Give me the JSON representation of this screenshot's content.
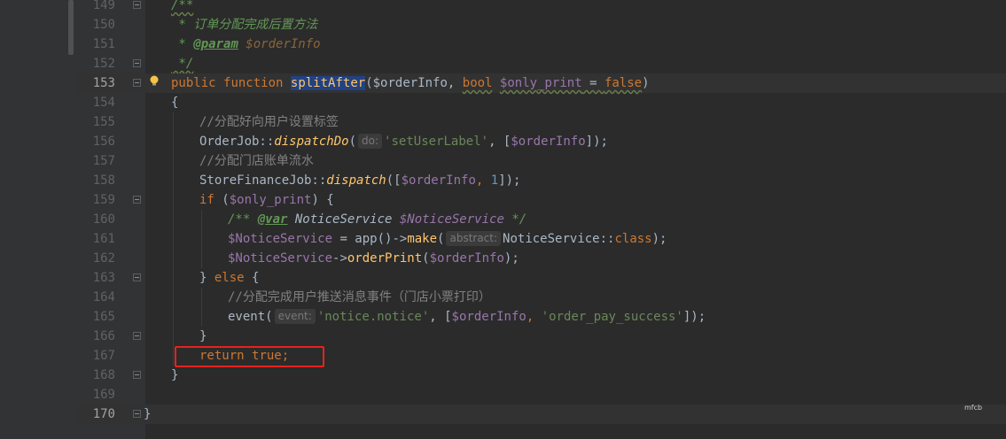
{
  "editor": {
    "current_line": "153",
    "watermark": "mfcb"
  },
  "lines": [
    {
      "n": "149"
    },
    {
      "n": "150"
    },
    {
      "n": "151"
    },
    {
      "n": "152"
    },
    {
      "n": "153"
    },
    {
      "n": "154"
    },
    {
      "n": "155"
    },
    {
      "n": "156"
    },
    {
      "n": "157"
    },
    {
      "n": "158"
    },
    {
      "n": "159"
    },
    {
      "n": "160"
    },
    {
      "n": "161"
    },
    {
      "n": "162"
    },
    {
      "n": "163"
    },
    {
      "n": "164"
    },
    {
      "n": "165"
    },
    {
      "n": "166"
    },
    {
      "n": "167"
    },
    {
      "n": "168"
    },
    {
      "n": "169"
    },
    {
      "n": "170"
    }
  ],
  "code": {
    "l149": "/**",
    "l150": " * 订单分配完成后置方法",
    "l151_star": " * ",
    "l151_tag": "@param",
    "l151_var": " $orderInfo",
    "l152": " */",
    "l153_kw1": "public",
    "l153_kw2": "function",
    "l153_fn": "splitAfter",
    "l153_p1": "($orderInfo, ",
    "l153_bool": "bool",
    "l153_var2": "$only_print",
    "l153_eq": " = ",
    "l153_false": "false",
    "l153_end": ")",
    "l154": "{",
    "l155": "//分配好向用户设置标签",
    "l156_cls": "OrderJob::",
    "l156_m": "dispatchDo",
    "l156_open": "(",
    "l156_hint": "do:",
    "l156_str": "'setUserLabel'",
    "l156_mid": ", [",
    "l156_var": "$orderInfo",
    "l156_end": "]);",
    "l157": "//分配门店账单流水",
    "l158_cls": "StoreFinanceJob::",
    "l158_m": "dispatch",
    "l158_open": "([",
    "l158_var": "$orderInfo",
    "l158_comma": ", ",
    "l158_num": "1",
    "l158_end": "]);",
    "l159_if": "if",
    "l159_open": " (",
    "l159_var": "$only_print",
    "l159_end": ") {",
    "l160_a": "/** ",
    "l160_tag": "@var",
    "l160_b": " NoticeService ",
    "l160_var": "$NoticeService",
    "l160_c": " */",
    "l161_var": "$NoticeService",
    "l161_eq": " = app()->",
    "l161_m": "make",
    "l161_open": "(",
    "l161_hint": "abstract:",
    "l161_cls": "NoticeService::",
    "l161_kw": "class",
    "l161_end": ");",
    "l162_var": "$NoticeService",
    "l162_arrow": "->",
    "l162_m": "orderPrint",
    "l162_open": "(",
    "l162_var2": "$orderInfo",
    "l162_end": ");",
    "l163_close": "} ",
    "l163_else": "else",
    "l163_end": " {",
    "l164": "//分配完成用户推送消息事件（门店小票打印）",
    "l165_fn": "event(",
    "l165_hint": "event:",
    "l165_str": "'notice.notice'",
    "l165_mid": ", [",
    "l165_var": "$orderInfo",
    "l165_comma": ", ",
    "l165_str2": "'order_pay_success'",
    "l165_end": "]);",
    "l166": "}",
    "l167_kw": "return",
    "l167_true": "true",
    "l167_end": ";",
    "l168": "}",
    "l169": "",
    "l170": "}"
  },
  "colors": {
    "background": "#2b2b2b",
    "gutter": "#313335",
    "keyword": "#cc7832",
    "string": "#6a8759",
    "variable": "#9876aa",
    "method": "#ffc66d",
    "comment": "#808080",
    "highlight_box": "#e5231f"
  },
  "icons": [
    "lightbulb-icon",
    "fold-marker-icon"
  ]
}
